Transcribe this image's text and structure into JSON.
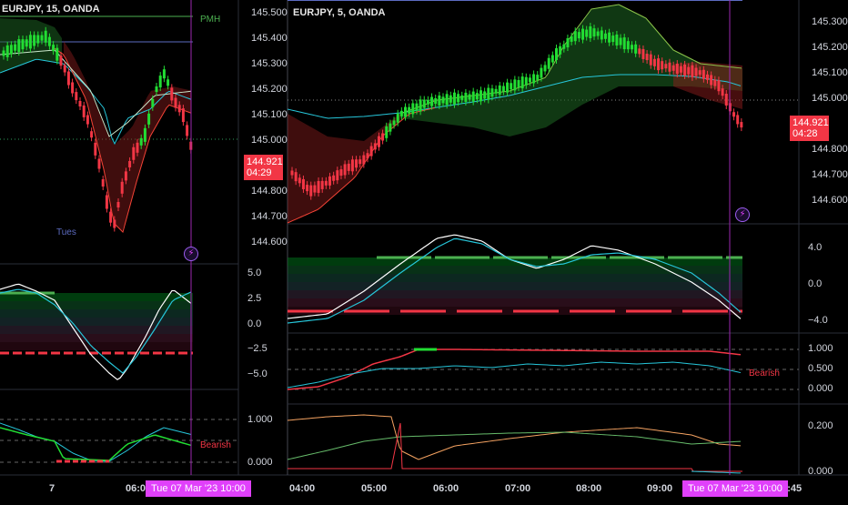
{
  "left_chart": {
    "symbol_title": "EURJPY, 15, OANDA",
    "price_axis": [
      "145.500",
      "145.400",
      "145.300",
      "145.200",
      "145.100",
      "145.000",
      "144.800",
      "144.700",
      "144.600"
    ],
    "last_price": "144.921",
    "countdown": "04:29",
    "pmh_label": "PMH",
    "tues_label": "Tues",
    "osc1_axis": [
      "5.0",
      "2.5",
      "0.0",
      "−2.5",
      "−5.0"
    ],
    "osc2_axis": [
      "1.000",
      "0.000"
    ],
    "bearish_label": "Bearish",
    "time_labels": [
      "7",
      "06:00"
    ]
  },
  "right_chart": {
    "symbol_title": "EURJPY, 5, OANDA",
    "price_axis": [
      "145.300",
      "145.200",
      "145.100",
      "145.000",
      "144.800",
      "144.700",
      "144.600"
    ],
    "last_price": "144.921",
    "countdown": "04:28",
    "osc1_axis": [
      "4.0",
      "0.0",
      "−4.0"
    ],
    "osc2_axis": [
      "1.000",
      "0.500",
      "0.000"
    ],
    "osc3_axis": [
      "0.200",
      "0.000"
    ],
    "bearish_label": "Bearish",
    "time_labels": [
      "04:00",
      "05:00",
      "06:00",
      "07:00",
      "08:00",
      "09:00",
      "10:45"
    ]
  },
  "crosshair_time_label": "Tue 07 Mar '23   10:00",
  "icons": {
    "alert_left": "lightning-bolt-icon",
    "alert_right": "lightning-bolt-icon"
  },
  "colors": {
    "bull": "#22dd33",
    "bear": "#f23645",
    "cyan": "#26c6da",
    "crosshair": "#9c27b0",
    "tag": "#e040fb",
    "pmh": "#4caf50",
    "pml": "#5c6bc0"
  }
}
